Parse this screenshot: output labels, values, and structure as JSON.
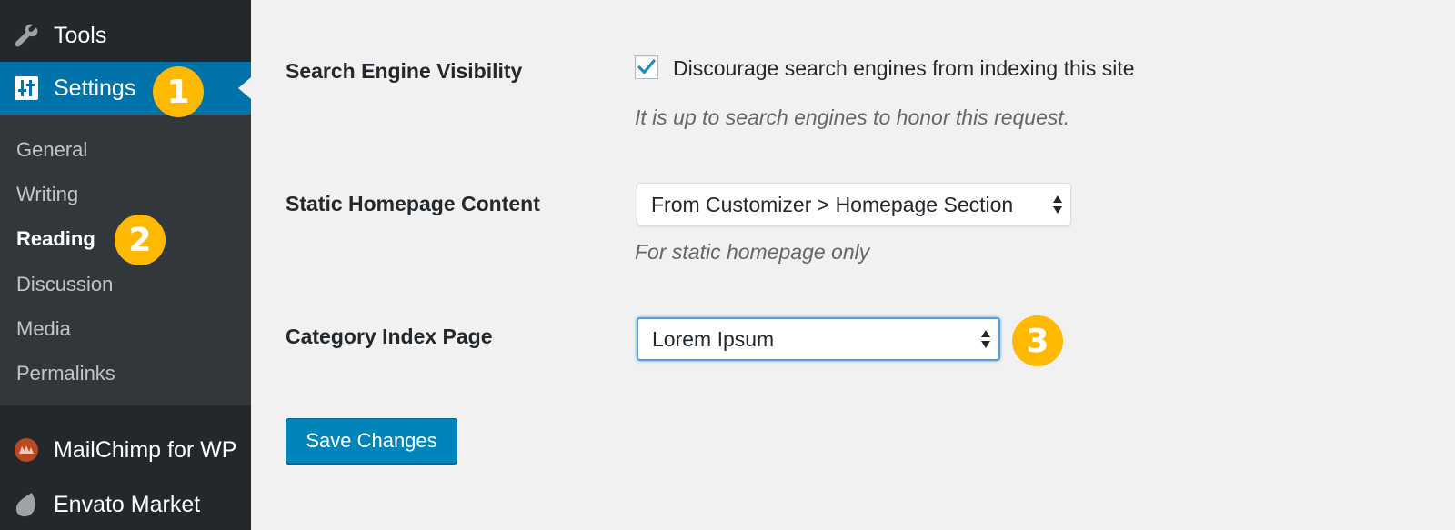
{
  "sidebar": {
    "tools": {
      "label": "Tools",
      "icon": "wrench-icon"
    },
    "settings": {
      "label": "Settings",
      "icon": "settings-sliders-icon",
      "badge": "1"
    },
    "submenu": [
      {
        "label": "General"
      },
      {
        "label": "Writing"
      },
      {
        "label": "Reading",
        "current": true,
        "badge": "2"
      },
      {
        "label": "Discussion"
      },
      {
        "label": "Media"
      },
      {
        "label": "Permalinks"
      }
    ],
    "mailchimp": {
      "label": "MailChimp for WP",
      "icon": "mailchimp-icon"
    },
    "envato": {
      "label": "Envato Market",
      "icon": "leaf-icon"
    }
  },
  "main": {
    "search_engine": {
      "label": "Search Engine Visibility",
      "checkbox_label": "Discourage search engines from indexing this site",
      "checked": true,
      "description": "It is up to search engines to honor this request."
    },
    "static_homepage": {
      "label": "Static Homepage Content",
      "selected": "From Customizer > Homepage Section",
      "description": "For static homepage only"
    },
    "category_index": {
      "label": "Category Index Page",
      "selected": "Lorem Ipsum",
      "badge": "3"
    },
    "save_button": "Save Changes"
  },
  "colors": {
    "sidebar_bg": "#23282d",
    "submenu_bg": "#32373c",
    "accent": "#0073aa",
    "badge": "#ffb900",
    "button": "#0085ba",
    "page_bg": "#f1f1f1"
  }
}
